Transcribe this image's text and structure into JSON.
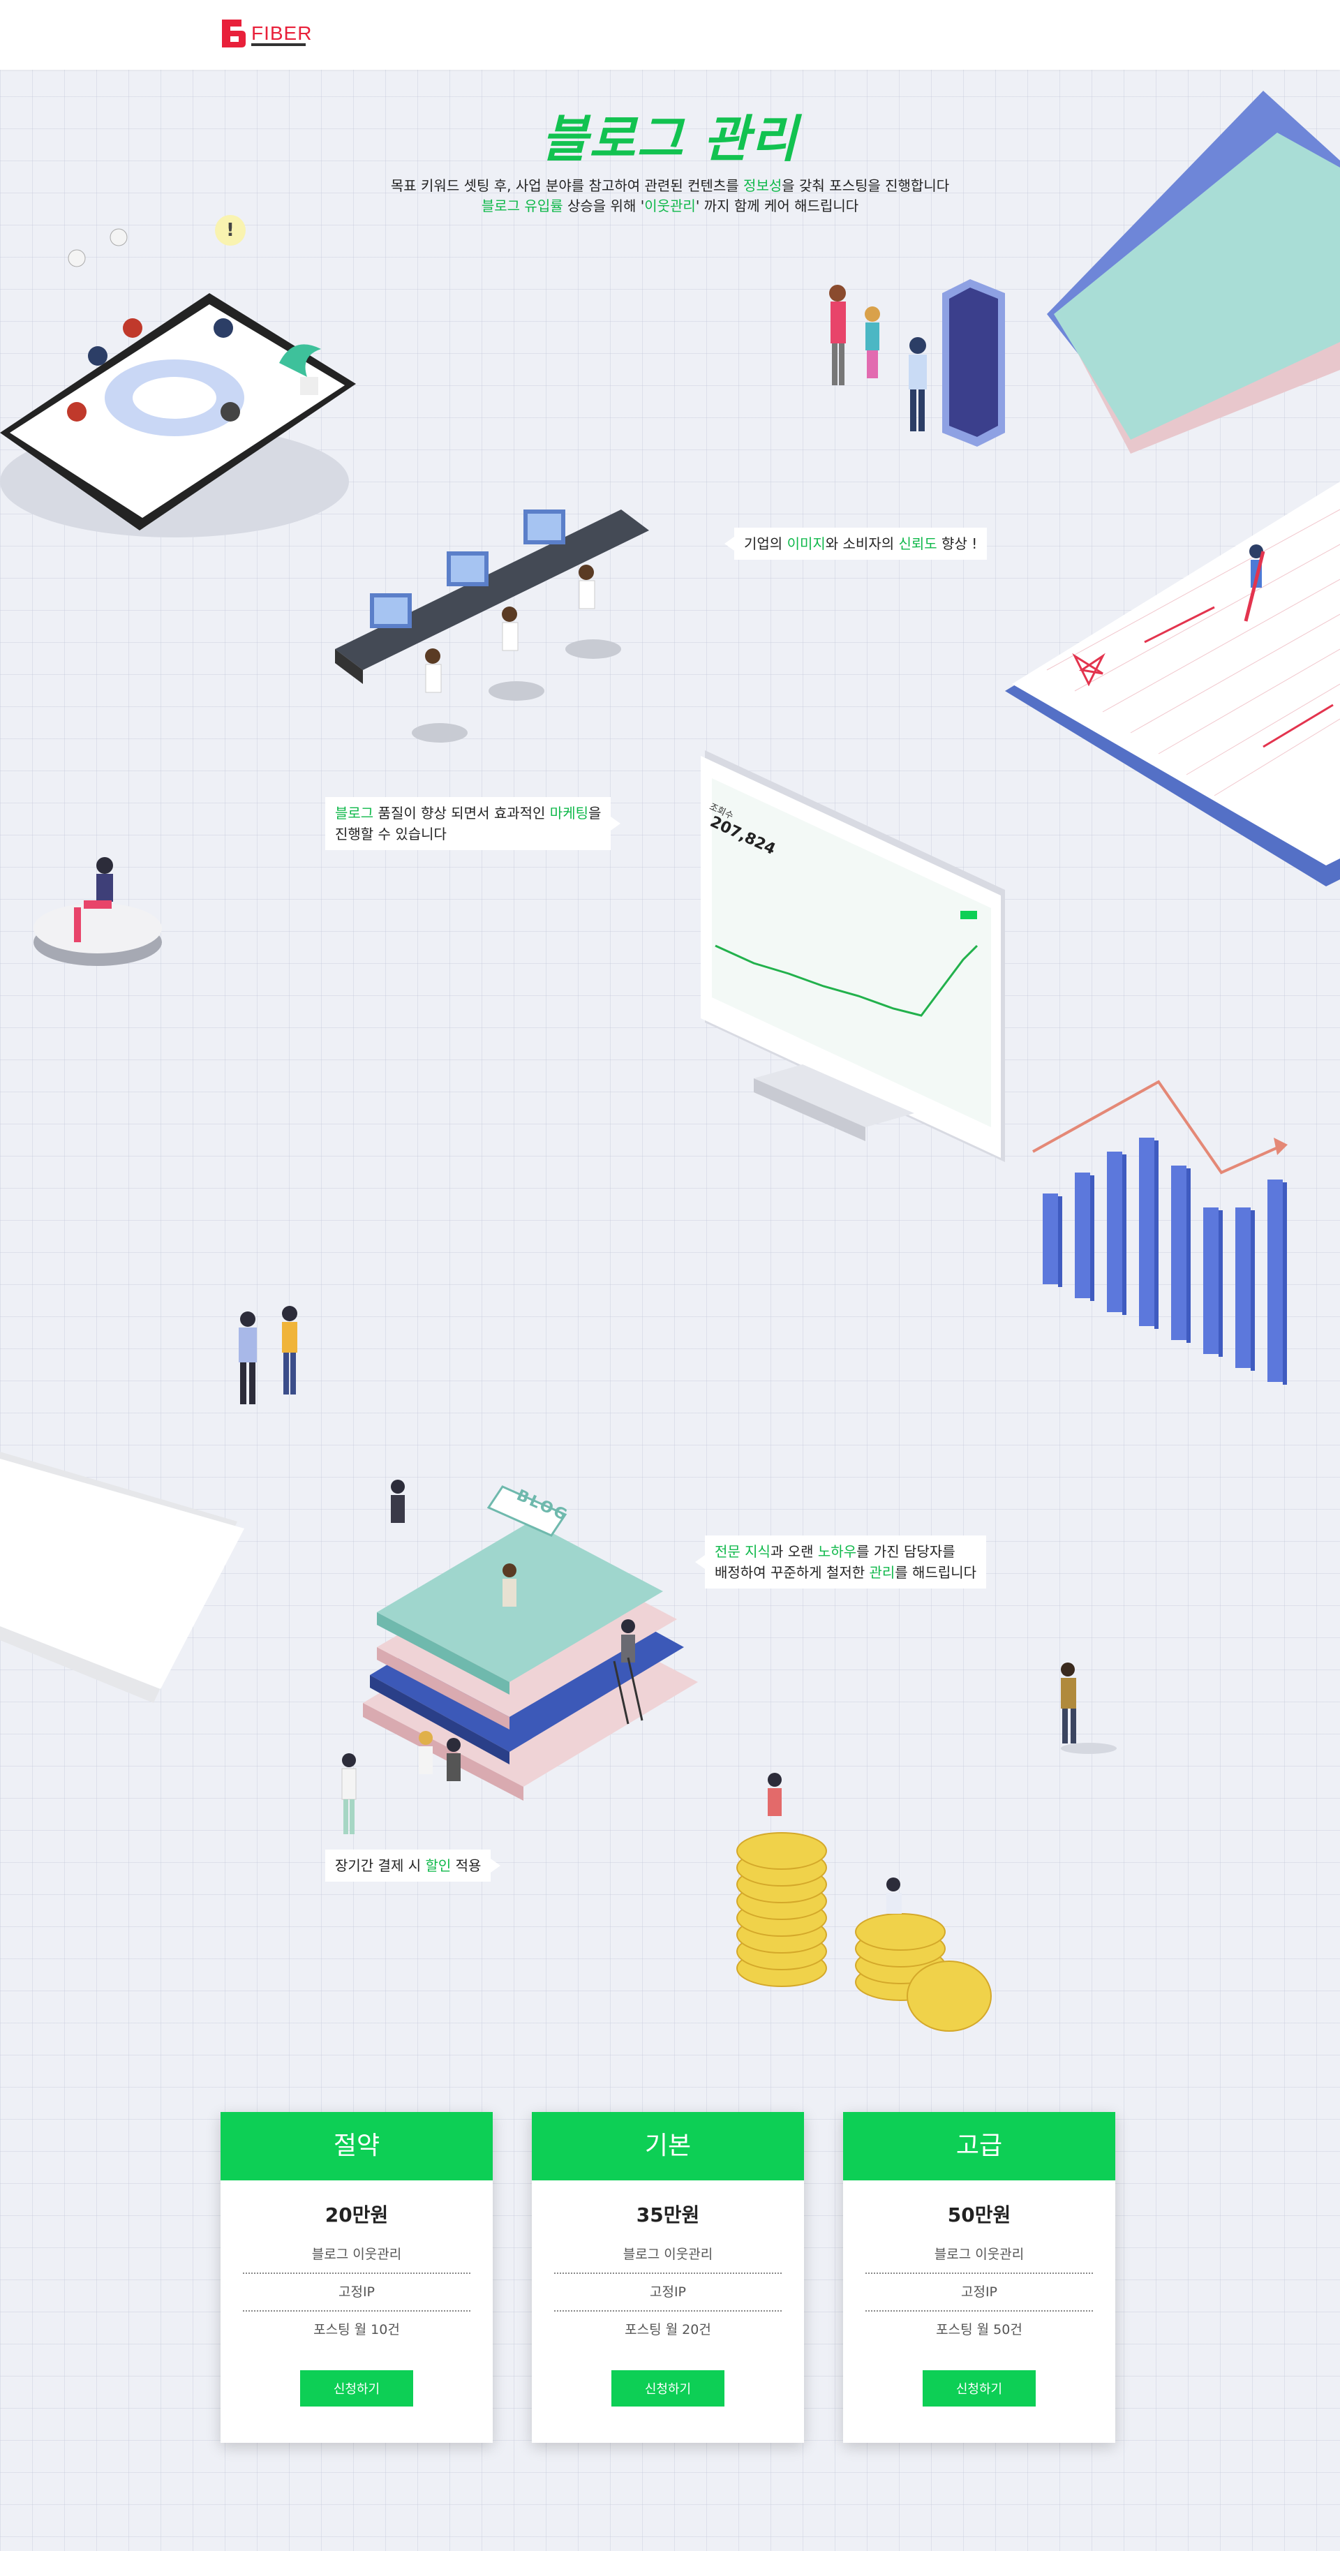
{
  "header": {
    "logo_text": "FIBER"
  },
  "hero": {
    "title": "블로그 관리",
    "subtitle_line1_parts": [
      "목표 키워드 셋팅 후, 사업 분야를 참고하여 관련된 컨텐츠를 ",
      "정보성",
      "을 갖춰 포스팅을 진행합니다"
    ],
    "subtitle_line2_parts": [
      "블로그 유입률",
      " 상승을 위해 '",
      "이웃관리",
      "' 까지 함께 케어 해드립니다"
    ]
  },
  "callouts": {
    "brand_image": [
      "기업의 ",
      "이미지",
      "와 소비자의 ",
      "신뢰도",
      " 향상 !"
    ],
    "blog_quality_line1": [
      "블로그",
      " 품질이 향상 되면서 효과적인 ",
      "마케팅",
      "을"
    ],
    "blog_quality_line2": "진행할 수 있습니다",
    "expert_line1": [
      "전문 지식",
      "과 오랜 ",
      "노하우",
      "를 가진 담당자를"
    ],
    "expert_line2": [
      "배정하여 꾸준하게 철저한 ",
      "관리",
      "를 해드립니다"
    ],
    "discount": [
      "장기간 결제 시 ",
      "할인",
      " 적용"
    ]
  },
  "monitor": {
    "screen_label": "조회수",
    "screen_value": "207,824",
    "book_label": "BLOG"
  },
  "colors": {
    "accent": "#0dcf55",
    "accent_text": "#12c250",
    "brand": "#e8203a"
  },
  "pricing": [
    {
      "name": "절약",
      "price": "20만원",
      "features": [
        "블로그 이웃관리",
        "고정IP",
        "포스팅 월 10건"
      ],
      "button": "신청하기"
    },
    {
      "name": "기본",
      "price": "35만원",
      "features": [
        "블로그 이웃관리",
        "고정IP",
        "포스팅 월 20건"
      ],
      "button": "신청하기"
    },
    {
      "name": "고급",
      "price": "50만원",
      "features": [
        "블로그 이웃관리",
        "고정IP",
        "포스팅 월 50건"
      ],
      "button": "신청하기"
    }
  ]
}
